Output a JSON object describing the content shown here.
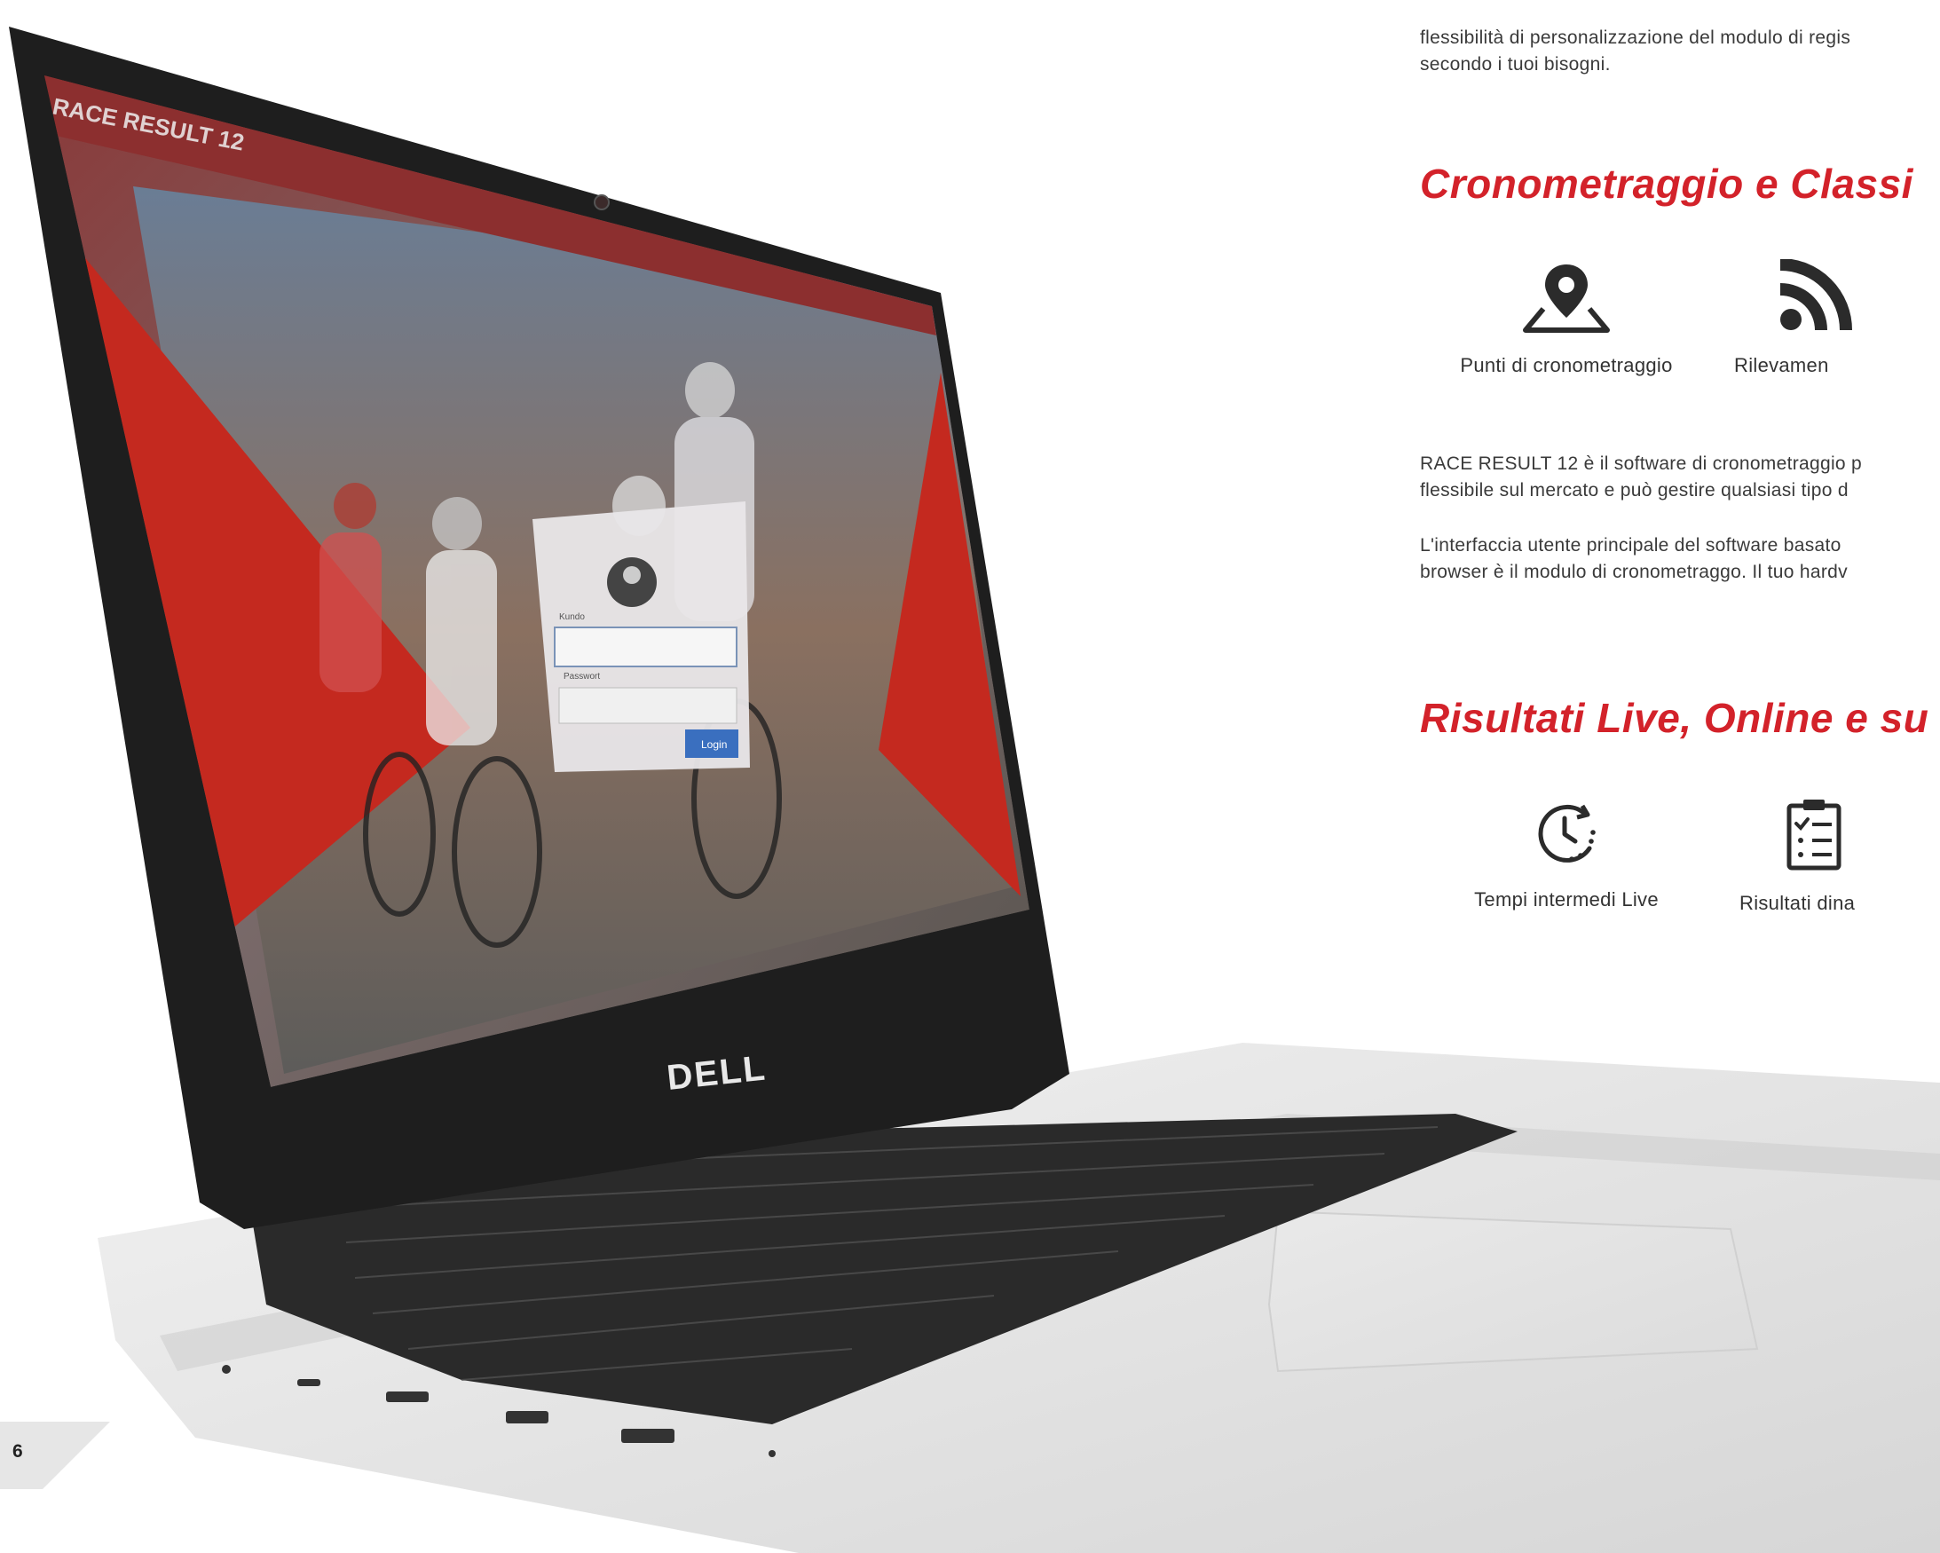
{
  "intro": {
    "line1": "flessibilità di personalizzazione del modulo di regis",
    "line2": "secondo i tuoi bisogni."
  },
  "sections": {
    "timing": {
      "heading": "Cronometraggio e Classi",
      "features": [
        {
          "label": "Punti di cronometraggio",
          "icon": "map-pin-icon"
        },
        {
          "label": "Rilevamen",
          "icon": "rss-feed-icon"
        }
      ],
      "para1": {
        "line1": "RACE RESULT 12 è il software di cronometraggio p",
        "line2": "flessibile sul mercato e può gestire qualsiasi tipo d"
      },
      "para2": {
        "line1": "L'interfaccia utente principale del software basato",
        "line2": "browser è il modulo di cronometraggo. Il tuo hardv"
      }
    },
    "results": {
      "heading": "Risultati Live, Online e su",
      "features": [
        {
          "label": "Tempi intermedi Live",
          "icon": "clock-history-icon"
        },
        {
          "label": "Risultati dina",
          "icon": "clipboard-checklist-icon"
        }
      ]
    }
  },
  "laptop": {
    "screen_title": "RACE RESULT 12",
    "brand": "DELL",
    "login": {
      "username_label": "Kundo",
      "password_label": "Passwort",
      "button": "Login"
    }
  },
  "page_number": "6",
  "colors": {
    "accent": "#d3222a",
    "text": "#333333",
    "corner": "#e6e6e6"
  }
}
